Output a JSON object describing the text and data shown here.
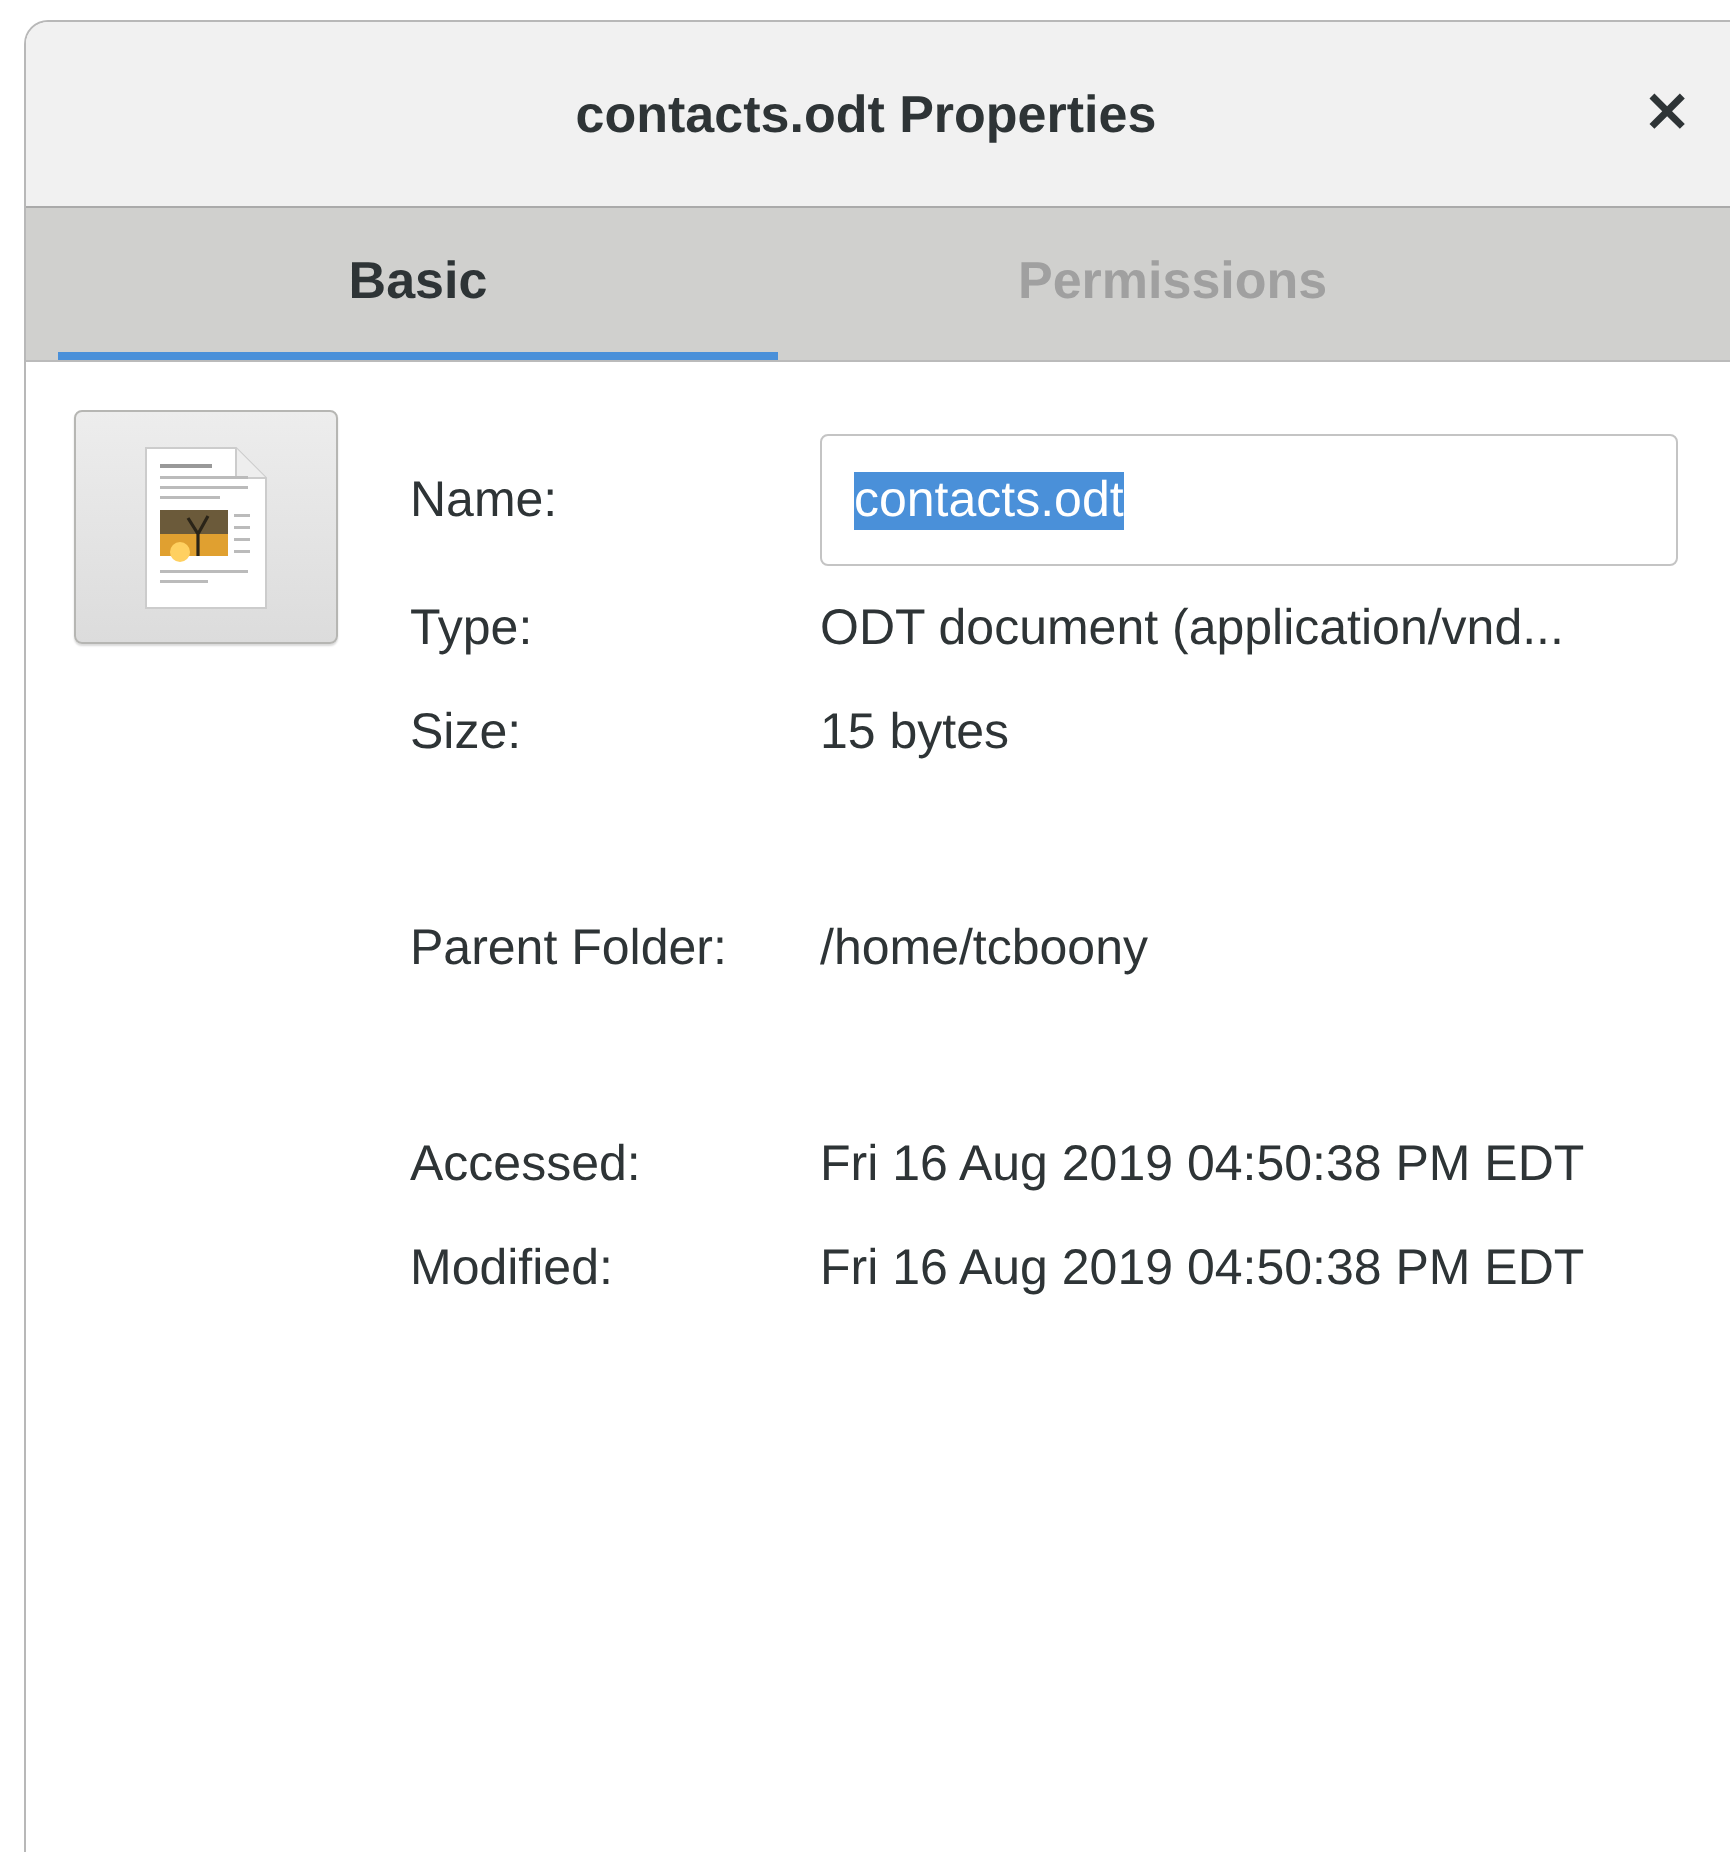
{
  "window": {
    "title": "contacts.odt Properties",
    "close": "×"
  },
  "tabs": [
    {
      "label": "Basic",
      "selected": true
    },
    {
      "label": "Permissions",
      "selected": false
    }
  ],
  "groups": [
    {
      "rows": [
        {
          "kind": "entry",
          "label": "Name:",
          "value": "contacts.odt",
          "text_selected": true
        },
        {
          "kind": "text",
          "label": "Type:",
          "value": "ODT document (application/vnd..."
        },
        {
          "kind": "text",
          "label": "Size:",
          "value": "15 bytes"
        }
      ]
    },
    {
      "rows": [
        {
          "kind": "text",
          "label": "Parent Folder:",
          "value": "/home/tcboony"
        }
      ]
    },
    {
      "rows": [
        {
          "kind": "text",
          "label": "Accessed:",
          "value": "Fri 16 Aug 2019 04:50:38 PM EDT"
        },
        {
          "kind": "text",
          "label": "Modified:",
          "value": "Fri 16 Aug 2019 04:50:38 PM EDT"
        }
      ]
    }
  ]
}
